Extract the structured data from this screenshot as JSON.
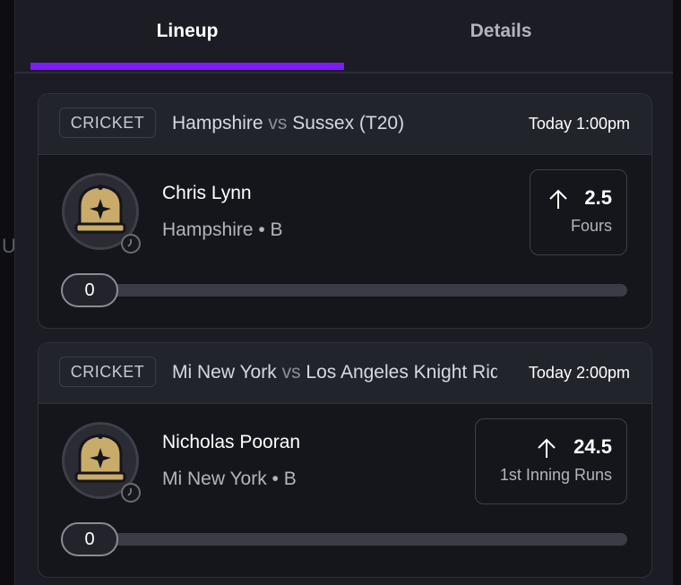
{
  "tabs": [
    {
      "label": "Lineup",
      "active": true
    },
    {
      "label": "Details",
      "active": false
    }
  ],
  "background_peek_text": "U",
  "accent_color": "#7d1cf7",
  "picks": [
    {
      "sport": "CRICKET",
      "team_home": "Hampshire",
      "vs": "vs",
      "team_away": "Sussex (T20)",
      "time": "Today 1:00pm",
      "player_name": "Chris Lynn",
      "player_meta": "Hampshire • B",
      "avatar_icon": "cricket-cap-icon",
      "line_direction": "up",
      "line_value": "2.5",
      "line_stat": "Fours",
      "progress_value": "0",
      "progress": 0
    },
    {
      "sport": "CRICKET",
      "team_home": "Mi New York",
      "vs": "vs",
      "team_away": "Los Angeles Knight Riders",
      "time": "Today 2:00pm",
      "player_name": "Nicholas Pooran",
      "player_meta": "Mi New York • B",
      "avatar_icon": "cricket-cap-icon",
      "line_direction": "up",
      "line_value": "24.5",
      "line_stat": "1st Inning Runs",
      "progress_value": "0",
      "progress": 0
    }
  ]
}
